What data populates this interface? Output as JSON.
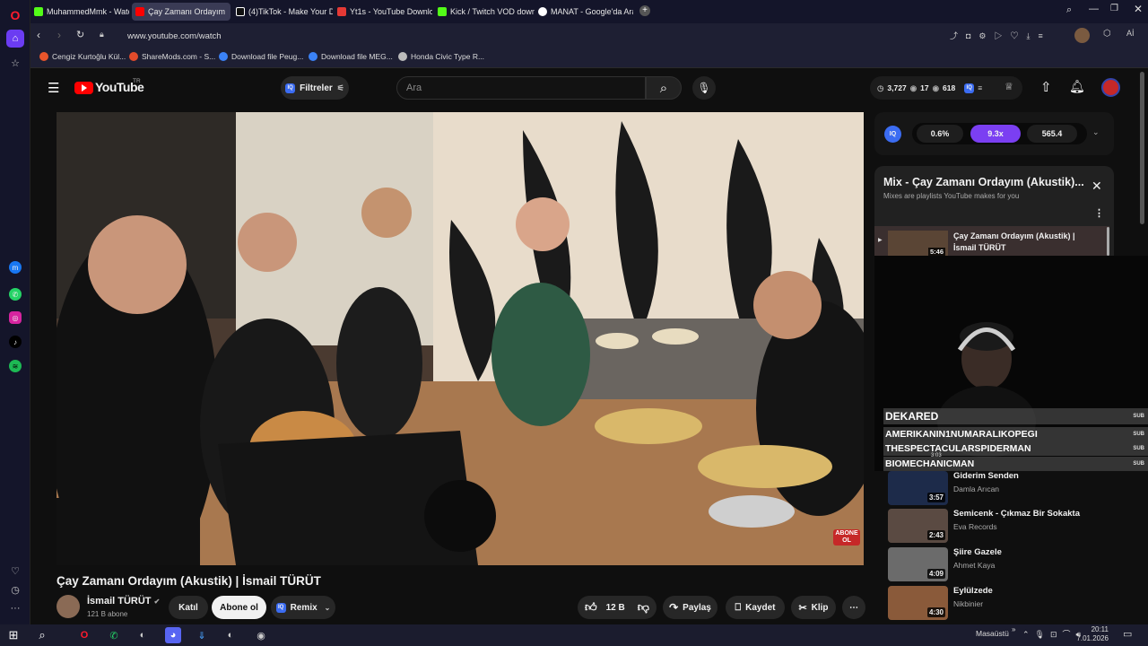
{
  "tabs": [
    {
      "label": "MuhammedMmk - Watch",
      "color": "#53fc18"
    },
    {
      "label": "Çay Zamanı Ordayım",
      "color": "#ff0000"
    },
    {
      "label": "(4)TikTok - Make Your Day",
      "color": "#ffffff"
    },
    {
      "label": "Yt1s - YouTube Download",
      "color": "#e53935"
    },
    {
      "label": "Kick / Twitch VOD downlo",
      "color": "#53fc18"
    },
    {
      "label": "MANAT - Google'da Ara",
      "color": "#ffffff"
    }
  ],
  "address": {
    "url": "www.youtube.com/watch"
  },
  "bookmarks": [
    {
      "label": "Cengiz Kurtoğlu Kül...",
      "color": "#e8552b"
    },
    {
      "label": "ShareMods.com - S...",
      "color": "#e24b2b"
    },
    {
      "label": "Download file Peug...",
      "color": "#3b82f6"
    },
    {
      "label": "Download file MEG...",
      "color": "#3b82f6"
    },
    {
      "label": "Honda Civic Type R...",
      "color": "#bbbbbb"
    }
  ],
  "youtube": {
    "logo_text": "YouTube",
    "region": "TR",
    "filters_label": "Filtreler",
    "search_placeholder": "Ara",
    "stats": {
      "a": "3,727",
      "b": "17",
      "c": "618"
    }
  },
  "iq": {
    "label": "IQ",
    "v1": "0.6%",
    "v2": "9.3x",
    "v3": "565.4"
  },
  "video": {
    "title": "Çay Zamanı Ordayım (Akustik) | İsmail TÜRÜT",
    "channel": "İsmail TÜRÜT",
    "subscribers": "121 B abone",
    "join_label": "Katıl",
    "subscribe_label": "Abone ol",
    "remix_label": "Remix",
    "likes": "12 B",
    "share_label": "Paylaş",
    "save_label": "Kaydet",
    "clip_label": "Klip",
    "watermark": "ABONE OL"
  },
  "mix": {
    "title": "Mix - Çay Zamanı Ordayım (Akustik)...",
    "subtitle": "Mixes are playlists YouTube makes for you",
    "current": {
      "title": "Çay Zamanı Ordayım (Akustik) | İsmail TÜRÜT",
      "duration": "5:46"
    }
  },
  "chat": {
    "sub_label": "SUB",
    "names": [
      "DEKARED",
      "AMERIKANIN1NUMARALIKOPEGI",
      "THESPECTACULARSPIDERMAN",
      "BIOMECHANICMAN"
    ],
    "hidden_duration": "3:03"
  },
  "recommendations": [
    {
      "title": "Giderim Senden",
      "channel": "Damla Arıcan",
      "duration": "3:57",
      "color": "#1d2b4a"
    },
    {
      "title": "Semicenk - Çıkmaz Bir Sokakta",
      "channel": "Eva Records",
      "duration": "2:43",
      "color": "#5a4a42"
    },
    {
      "title": "Şiire Gazele",
      "channel": "Ahmet Kaya",
      "duration": "4:09",
      "color": "#6b6b6b"
    },
    {
      "title": "Eylülzede",
      "channel": "Nikbinier",
      "duration": "4:30",
      "color": "#8a5a3a"
    }
  ],
  "taskbar": {
    "desktop_label": "Masaüstü",
    "time": "20:11",
    "date": "7.01.2026"
  },
  "colors": {
    "youtube_red": "#ff0000",
    "iq_purple": "#7b3ff2",
    "subscribe_bg": "#f1f1f1"
  }
}
